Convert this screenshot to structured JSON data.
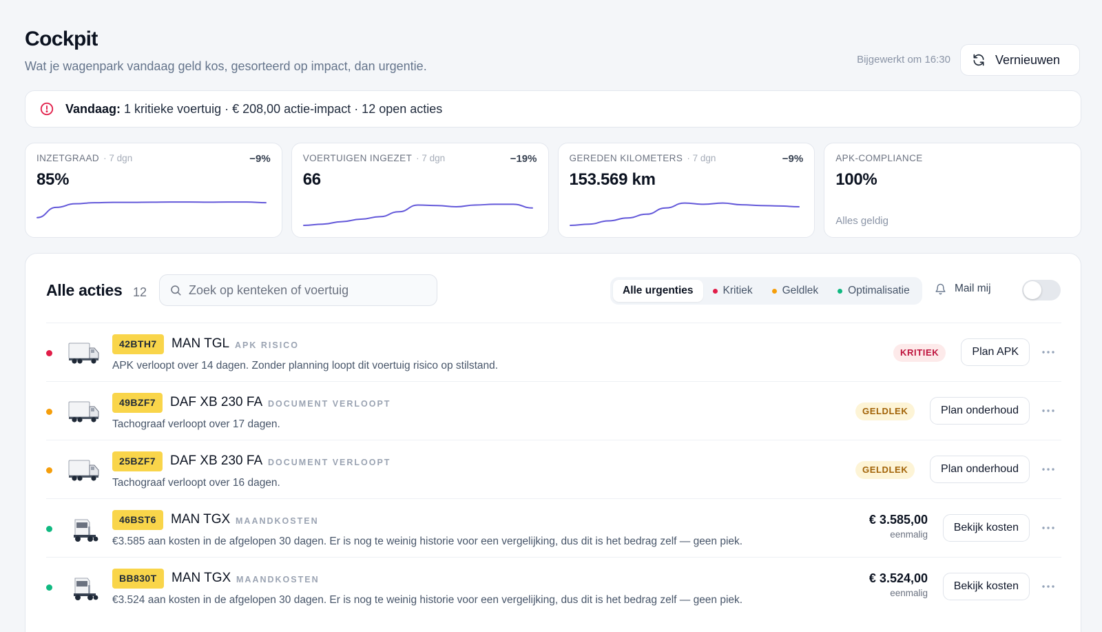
{
  "header": {
    "title": "Cockpit",
    "subtitle": "Wat je wagenpark vandaag geld kos, gesorteerd op impact, dan urgentie.",
    "updated": "Bijgewerkt om 16:30",
    "refresh_label": "Vernieuwen"
  },
  "alert": {
    "prefix": "Vandaag:",
    "text": "1 kritieke voertuig · € 208,00 actie-impact · 12 open acties",
    "color": "#e11d48"
  },
  "kpis": [
    {
      "label": "INZETGRAAD",
      "period": "· 7 dgn",
      "delta": "−9%",
      "value": "85%",
      "trend": [
        0.05,
        0.62,
        0.82,
        0.88,
        0.9,
        0.9,
        0.91,
        0.92,
        0.92,
        0.91,
        0.92,
        0.92,
        0.88
      ]
    },
    {
      "label": "VOERTUIGEN INGEZET",
      "period": "· 7 dgn",
      "delta": "−19%",
      "value": "66",
      "trend": [
        0.0,
        0.05,
        0.15,
        0.25,
        0.35,
        0.55,
        0.82,
        0.8,
        0.75,
        0.82,
        0.85,
        0.85,
        0.7
      ]
    },
    {
      "label": "GEREDEN KILOMETERS",
      "period": "· 7 dgn",
      "delta": "−9%",
      "value": "153.569 km",
      "trend": [
        0.0,
        0.05,
        0.18,
        0.3,
        0.45,
        0.7,
        0.9,
        0.85,
        0.9,
        0.83,
        0.8,
        0.78,
        0.75
      ]
    },
    {
      "label": "APK-COMPLIANCE",
      "period": "",
      "delta": "",
      "value": "100%",
      "note": "Alles geldig"
    }
  ],
  "actions": {
    "title": "Alle acties",
    "count": "12",
    "search_placeholder": "Zoek op kenteken of voertuig",
    "filters": [
      {
        "label": "Alle urgenties",
        "active": true,
        "color": ""
      },
      {
        "label": "Kritiek",
        "active": false,
        "color": "#e11d48"
      },
      {
        "label": "Geldlek",
        "active": false,
        "color": "#f59e0b"
      },
      {
        "label": "Optimalisatie",
        "active": false,
        "color": "#10b981"
      }
    ],
    "mail_label": "Mail mij",
    "mail_enabled": false,
    "accent_color": "#6257d9",
    "rows": [
      {
        "urgency": "#e11d48",
        "vehicle": "box-truck",
        "plate": "42BTH7",
        "model": "MAN TGL",
        "tag": "APK RISICO",
        "desc": "APK verloopt over 14 dagen. Zonder planning loopt dit voertuig risico op stilstand.",
        "badge": "KRITIEK",
        "badge_type": "kritiek",
        "amount": "",
        "amount_sub": "",
        "action": "Plan APK"
      },
      {
        "urgency": "#f59e0b",
        "vehicle": "box-truck",
        "plate": "49BZF7",
        "model": "DAF XB 230 FA",
        "tag": "DOCUMENT VERLOOPT",
        "desc": "Tachograaf verloopt over 17 dagen.",
        "badge": "GELDLEK",
        "badge_type": "geldlek",
        "amount": "",
        "amount_sub": "",
        "action": "Plan onderhoud"
      },
      {
        "urgency": "#f59e0b",
        "vehicle": "box-truck",
        "plate": "25BZF7",
        "model": "DAF XB 230 FA",
        "tag": "DOCUMENT VERLOOPT",
        "desc": "Tachograaf verloopt over 16 dagen.",
        "badge": "GELDLEK",
        "badge_type": "geldlek",
        "amount": "",
        "amount_sub": "",
        "action": "Plan onderhoud"
      },
      {
        "urgency": "#10b981",
        "vehicle": "tractor",
        "plate": "46BST6",
        "model": "MAN TGX",
        "tag": "MAANDKOSTEN",
        "desc": "€3.585 aan kosten in de afgelopen 30 dagen. Er is nog te weinig historie voor een vergelijking, dus dit is het bedrag zelf — geen piek.",
        "badge": "",
        "badge_type": "",
        "amount": "€ 3.585,00",
        "amount_sub": "eenmalig",
        "action": "Bekijk kosten"
      },
      {
        "urgency": "#10b981",
        "vehicle": "tractor",
        "plate": "BB830T",
        "model": "MAN TGX",
        "tag": "MAANDKOSTEN",
        "desc": "€3.524 aan kosten in de afgelopen 30 dagen. Er is nog te weinig historie voor een vergelijking, dus dit is het bedrag zelf — geen piek.",
        "badge": "",
        "badge_type": "",
        "amount": "€ 3.524,00",
        "amount_sub": "eenmalig",
        "action": "Bekijk kosten"
      }
    ]
  }
}
